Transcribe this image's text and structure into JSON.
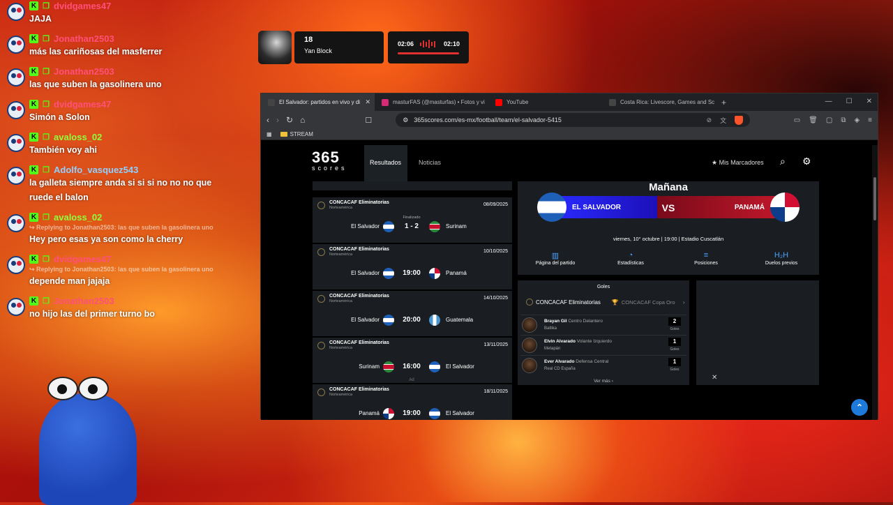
{
  "chat": {
    "messages": [
      {
        "user": "dvidgames47",
        "color": "#ff4f7a",
        "text": "JAJA",
        "reply": ""
      },
      {
        "user": "Jonathan2503",
        "color": "#ff4f7a",
        "text": "más las cariñosas del masferrer",
        "reply": ""
      },
      {
        "user": "Jonathan2503",
        "color": "#ff4f7a",
        "text": "las que suben la gasolinera uno",
        "reply": ""
      },
      {
        "user": "dvidgames47",
        "color": "#ff4f7a",
        "text": "Simón a Solon",
        "reply": ""
      },
      {
        "user": "avaloss_02",
        "color": "#8fff3c",
        "text": "También voy ahi",
        "reply": ""
      },
      {
        "user": "Adolfo_vasquez543",
        "color": "#8fd0ff",
        "text": "la galleta siempre anda si si si no no no que ruede el balon",
        "reply": ""
      },
      {
        "user": "avaloss_02",
        "color": "#8fff3c",
        "text": "Hey pero esas ya son como la cherry",
        "reply": "↪ Replying to Jonathan2503: las que suben la gasolinera uno"
      },
      {
        "user": "dvidgames47",
        "color": "#ff4f7a",
        "text": "depende man jajaja",
        "reply": "↪ Replying to Jonathan2503: las que suben la gasolinera uno"
      },
      {
        "user": "Jonathan2503",
        "color": "#ff4f7a",
        "text": "no hijo las del primer turno bo",
        "reply": ""
      }
    ]
  },
  "music": {
    "rank": "18",
    "artist": "Yan Block",
    "elapsed": "02:06",
    "total": "02:10"
  },
  "browser": {
    "tabs": [
      {
        "label": "El Salvador: partidos en vivo y di",
        "favicon": "#444",
        "active": true
      },
      {
        "label": "masturFAS (@masturfas) • Fotos y vi",
        "favicon": "#d62976",
        "active": false
      },
      {
        "label": "YouTube",
        "favicon": "#ff0000",
        "active": false
      },
      {
        "label": "Costa Rica: Livescore, Games and Sc",
        "favicon": "#444",
        "active": false
      }
    ],
    "url": "365scores.com/es-mx/football/team/el-salvador-5415",
    "bookmark": "STREAM"
  },
  "site": {
    "logo_top": "365",
    "logo_bottom": "scores",
    "nav_results": "Resultados",
    "nav_news": "Noticias",
    "my_scores": "Mis Marcadores",
    "matches": [
      {
        "comp": "CONCACAF Eliminatorias",
        "region": "Norteamérica",
        "date": "08/09/2025",
        "home": "El Salvador",
        "away": "Surinam",
        "center": "1 - 2",
        "status": "Finalizado",
        "f1": "fl-sv",
        "f2": "fl-sr",
        "ad": ""
      },
      {
        "comp": "CONCACAF Eliminatorias",
        "region": "Norteamérica",
        "date": "10/10/2025",
        "home": "El Salvador",
        "away": "Panamá",
        "center": "19:00",
        "status": "",
        "f1": "fl-sv",
        "f2": "fl-pa",
        "ad": ""
      },
      {
        "comp": "CONCACAF Eliminatorias",
        "region": "Norteamérica",
        "date": "14/10/2025",
        "home": "El Salvador",
        "away": "Guatemala",
        "center": "20:00",
        "status": "",
        "f1": "fl-sv",
        "f2": "fl-gt",
        "ad": ""
      },
      {
        "comp": "CONCACAF Eliminatorias",
        "region": "Norteamérica",
        "date": "13/11/2025",
        "home": "Surinam",
        "away": "El Salvador",
        "center": "16:00",
        "status": "",
        "f1": "fl-sr",
        "f2": "fl-sv",
        "ad": "Ad"
      },
      {
        "comp": "CONCACAF Eliminatorias",
        "region": "Norteamérica",
        "date": "18/11/2025",
        "home": "Panamá",
        "away": "El Salvador",
        "center": "19:00",
        "status": "",
        "f1": "fl-pa",
        "f2": "fl-sv",
        "ad": ""
      }
    ],
    "next_match": {
      "title": "Mañana",
      "home": "EL SALVADOR",
      "away": "PANAMÁ",
      "vs": "VS",
      "info": "viernes, 10° octubre | 19:00 | Estadio Cuscatlán",
      "actions": [
        {
          "label": "Página del partido",
          "icon": "bar-chart-icon",
          "glyph": "▥"
        },
        {
          "label": "Estadísticas",
          "icon": "stats-icon",
          "glyph": "◔"
        },
        {
          "label": "Posiciones",
          "icon": "standings-icon",
          "glyph": "≡"
        },
        {
          "label": "Duelos previos",
          "icon": "h2h-icon",
          "glyph": "H₂H"
        }
      ]
    },
    "goals": {
      "title": "Goles",
      "competition": "CONCACAF Eliminatorias",
      "competition2": "CONCACAF Copa Oro",
      "players": [
        {
          "name": "Brayan Gil",
          "position": "Centro Delantero",
          "club": "Baltika",
          "goals": "2"
        },
        {
          "name": "Elvin Alvarado",
          "position": "Volante Izquierdo",
          "club": "Metapán",
          "goals": "1"
        },
        {
          "name": "Ever Alvarado",
          "position": "Defensa Central",
          "club": "Real CD España",
          "goals": "1"
        }
      ],
      "goals_label": "Goles",
      "more": "Ver más"
    }
  }
}
